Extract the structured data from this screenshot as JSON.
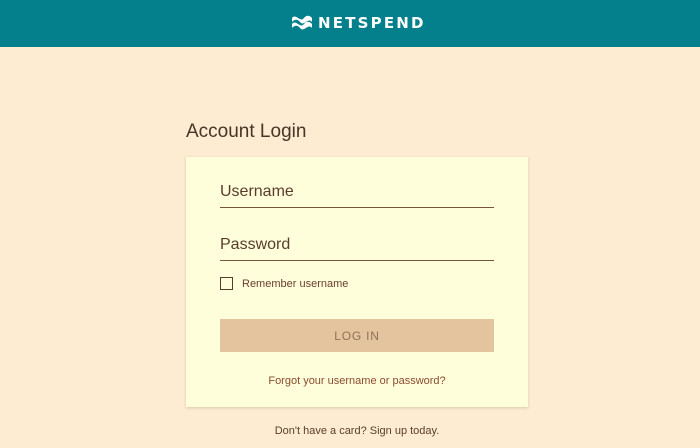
{
  "header": {
    "brand_name": "NETSPEND",
    "background_color": "#047f8c"
  },
  "page": {
    "title": "Account Login",
    "background_color": "#fdecd2"
  },
  "form": {
    "username_placeholder": "Username",
    "username_value": "",
    "password_placeholder": "Password",
    "password_value": "",
    "remember_label": "Remember username",
    "remember_checked": false,
    "login_label": "LOG IN",
    "forgot_link": "Forgot your username or password?"
  },
  "footer": {
    "signup_link": "Don't have a card? Sign up today."
  },
  "icons": {
    "logo": "netspend-logo-icon"
  }
}
